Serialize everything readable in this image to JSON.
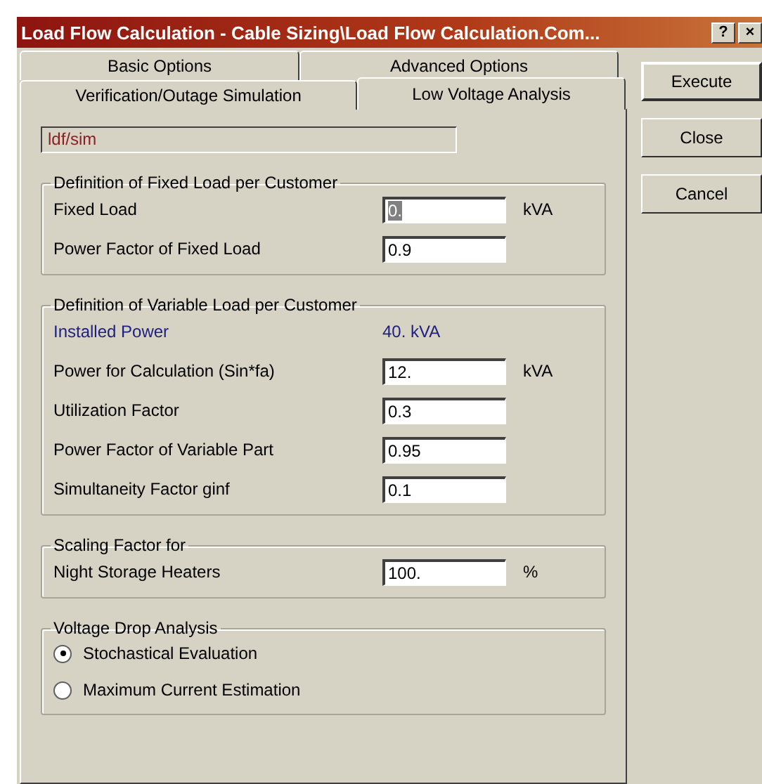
{
  "window": {
    "title": "Load Flow Calculation - Cable Sizing\\Load Flow Calculation.Com...",
    "title_buttons": [
      "?",
      "×"
    ]
  },
  "tab_rows": [
    [
      {
        "label": "Basic Options",
        "selected": false
      },
      {
        "label": "Advanced Options",
        "selected": false
      }
    ],
    [
      {
        "label": "Verification/Outage Simulation",
        "selected": false
      },
      {
        "label": "Low Voltage Analysis",
        "selected": true
      }
    ]
  ],
  "path_field": {
    "value": "ldf/sim"
  },
  "groups": [
    {
      "title": "Definition of Fixed Load per Customer",
      "rows": [
        {
          "kind": "field",
          "label": "Fixed Load",
          "value": "0.",
          "unit": "kVA",
          "text_selected": true
        },
        {
          "kind": "field",
          "label": "Power Factor of Fixed Load",
          "value": "0.9",
          "text_selected": false
        }
      ]
    },
    {
      "title": "Definition of Variable Load per Customer",
      "rows": [
        {
          "kind": "info",
          "label": "Installed Power",
          "value": "40. kVA"
        },
        {
          "kind": "field",
          "label": "Power for Calculation (Sin*fa)",
          "value": "12.",
          "unit": "kVA",
          "text_selected": false
        },
        {
          "kind": "field",
          "label": "Utilization Factor",
          "value": "0.3",
          "text_selected": false
        },
        {
          "kind": "field",
          "label": "Power Factor of Variable Part",
          "value": "0.95",
          "text_selected": false
        },
        {
          "kind": "field",
          "label": "Simultaneity Factor ginf",
          "value": "0.1",
          "text_selected": false
        }
      ]
    },
    {
      "title": "Scaling Factor for",
      "rows": [
        {
          "kind": "field",
          "label": "Night Storage Heaters",
          "value": "100.",
          "unit": "%",
          "text_selected": false
        }
      ]
    },
    {
      "title": "Voltage Drop Analysis",
      "rows": [
        {
          "kind": "radio",
          "label": "Stochastical Evaluation",
          "selected": true
        },
        {
          "kind": "radio",
          "label": "Maximum Current Estimation",
          "selected": false
        }
      ]
    }
  ],
  "buttons": [
    "Execute",
    "Close",
    "Cancel"
  ]
}
